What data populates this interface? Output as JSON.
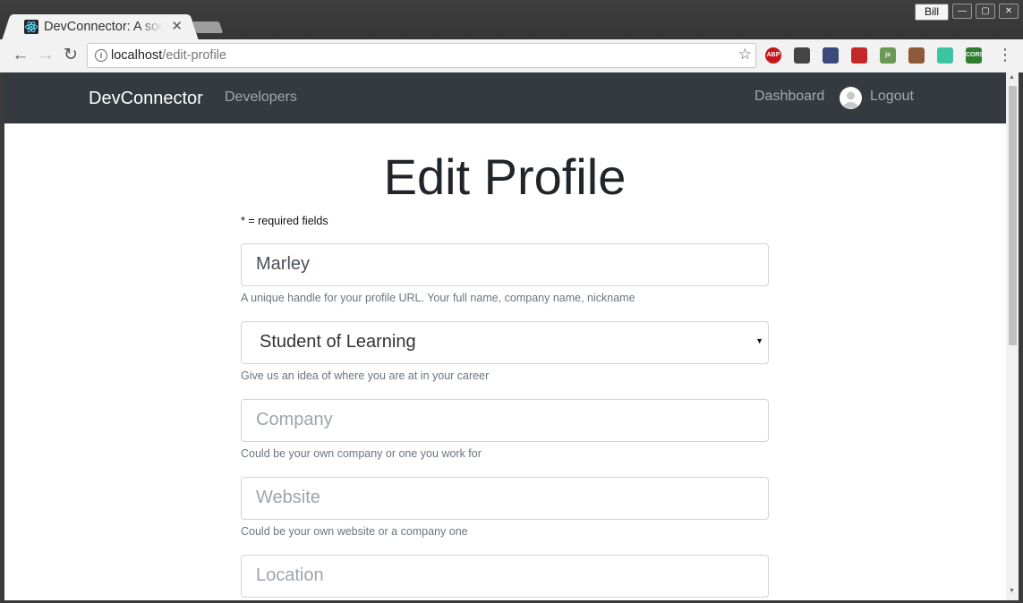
{
  "browser": {
    "tab_title": "DevConnector: A social network for developers",
    "user_name": "Bill",
    "url_host": "localhost",
    "url_path": "/edit-profile",
    "extensions": [
      {
        "name": "adblock-icon",
        "label": "ABP",
        "color": "#c7161b"
      },
      {
        "name": "sync-icon",
        "label": "",
        "color": "#444444"
      },
      {
        "name": "react-devtools-icon",
        "label": "",
        "color": "#3a4a7a"
      },
      {
        "name": "redux-devtools-icon",
        "label": "",
        "color": "#c62828"
      },
      {
        "name": "js-icon",
        "label": "js",
        "color": "#6a9955"
      },
      {
        "name": "monkey-icon",
        "label": "",
        "color": "#8d5a3b"
      },
      {
        "name": "target-icon",
        "label": "",
        "color": "#3cc4a0"
      },
      {
        "name": "cors-icon",
        "label": "CORS",
        "color": "#2e7d32"
      }
    ]
  },
  "navbar": {
    "brand": "DevConnector",
    "developers": "Developers",
    "dashboard": "Dashboard",
    "logout": "Logout",
    "background": "#343a40"
  },
  "page": {
    "title": "Edit Profile",
    "required_note": "* = required fields",
    "handle": {
      "value": "Marley",
      "help": "A unique handle for your profile URL. Your full name, company name, nickname"
    },
    "status": {
      "value": "Student of Learning",
      "help": "Give us an idea of where you are at in your career"
    },
    "company": {
      "placeholder": "Company",
      "help": "Could be your own company or one you work for"
    },
    "website": {
      "placeholder": "Website",
      "help": "Could be your own website or a company one"
    },
    "location": {
      "placeholder": "Location"
    }
  }
}
